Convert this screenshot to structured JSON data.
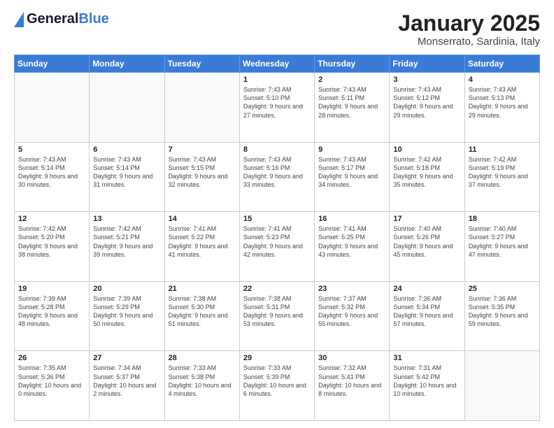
{
  "header": {
    "logo_general": "General",
    "logo_blue": "Blue",
    "title": "January 2025",
    "location": "Monserrato, Sardinia, Italy"
  },
  "weekdays": [
    "Sunday",
    "Monday",
    "Tuesday",
    "Wednesday",
    "Thursday",
    "Friday",
    "Saturday"
  ],
  "weeks": [
    [
      {
        "day": "",
        "info": ""
      },
      {
        "day": "",
        "info": ""
      },
      {
        "day": "",
        "info": ""
      },
      {
        "day": "1",
        "info": "Sunrise: 7:43 AM\nSunset: 5:10 PM\nDaylight: 9 hours and 27 minutes."
      },
      {
        "day": "2",
        "info": "Sunrise: 7:43 AM\nSunset: 5:11 PM\nDaylight: 9 hours and 28 minutes."
      },
      {
        "day": "3",
        "info": "Sunrise: 7:43 AM\nSunset: 5:12 PM\nDaylight: 9 hours and 29 minutes."
      },
      {
        "day": "4",
        "info": "Sunrise: 7:43 AM\nSunset: 5:13 PM\nDaylight: 9 hours and 29 minutes."
      }
    ],
    [
      {
        "day": "5",
        "info": "Sunrise: 7:43 AM\nSunset: 5:14 PM\nDaylight: 9 hours and 30 minutes."
      },
      {
        "day": "6",
        "info": "Sunrise: 7:43 AM\nSunset: 5:14 PM\nDaylight: 9 hours and 31 minutes."
      },
      {
        "day": "7",
        "info": "Sunrise: 7:43 AM\nSunset: 5:15 PM\nDaylight: 9 hours and 32 minutes."
      },
      {
        "day": "8",
        "info": "Sunrise: 7:43 AM\nSunset: 5:16 PM\nDaylight: 9 hours and 33 minutes."
      },
      {
        "day": "9",
        "info": "Sunrise: 7:43 AM\nSunset: 5:17 PM\nDaylight: 9 hours and 34 minutes."
      },
      {
        "day": "10",
        "info": "Sunrise: 7:42 AM\nSunset: 5:18 PM\nDaylight: 9 hours and 35 minutes."
      },
      {
        "day": "11",
        "info": "Sunrise: 7:42 AM\nSunset: 5:19 PM\nDaylight: 9 hours and 37 minutes."
      }
    ],
    [
      {
        "day": "12",
        "info": "Sunrise: 7:42 AM\nSunset: 5:20 PM\nDaylight: 9 hours and 38 minutes."
      },
      {
        "day": "13",
        "info": "Sunrise: 7:42 AM\nSunset: 5:21 PM\nDaylight: 9 hours and 39 minutes."
      },
      {
        "day": "14",
        "info": "Sunrise: 7:41 AM\nSunset: 5:22 PM\nDaylight: 9 hours and 41 minutes."
      },
      {
        "day": "15",
        "info": "Sunrise: 7:41 AM\nSunset: 5:23 PM\nDaylight: 9 hours and 42 minutes."
      },
      {
        "day": "16",
        "info": "Sunrise: 7:41 AM\nSunset: 5:25 PM\nDaylight: 9 hours and 43 minutes."
      },
      {
        "day": "17",
        "info": "Sunrise: 7:40 AM\nSunset: 5:26 PM\nDaylight: 9 hours and 45 minutes."
      },
      {
        "day": "18",
        "info": "Sunrise: 7:40 AM\nSunset: 5:27 PM\nDaylight: 9 hours and 47 minutes."
      }
    ],
    [
      {
        "day": "19",
        "info": "Sunrise: 7:39 AM\nSunset: 5:28 PM\nDaylight: 9 hours and 48 minutes."
      },
      {
        "day": "20",
        "info": "Sunrise: 7:39 AM\nSunset: 5:29 PM\nDaylight: 9 hours and 50 minutes."
      },
      {
        "day": "21",
        "info": "Sunrise: 7:38 AM\nSunset: 5:30 PM\nDaylight: 9 hours and 51 minutes."
      },
      {
        "day": "22",
        "info": "Sunrise: 7:38 AM\nSunset: 5:31 PM\nDaylight: 9 hours and 53 minutes."
      },
      {
        "day": "23",
        "info": "Sunrise: 7:37 AM\nSunset: 5:32 PM\nDaylight: 9 hours and 55 minutes."
      },
      {
        "day": "24",
        "info": "Sunrise: 7:36 AM\nSunset: 5:34 PM\nDaylight: 9 hours and 57 minutes."
      },
      {
        "day": "25",
        "info": "Sunrise: 7:36 AM\nSunset: 5:35 PM\nDaylight: 9 hours and 59 minutes."
      }
    ],
    [
      {
        "day": "26",
        "info": "Sunrise: 7:35 AM\nSunset: 5:36 PM\nDaylight: 10 hours and 0 minutes."
      },
      {
        "day": "27",
        "info": "Sunrise: 7:34 AM\nSunset: 5:37 PM\nDaylight: 10 hours and 2 minutes."
      },
      {
        "day": "28",
        "info": "Sunrise: 7:33 AM\nSunset: 5:38 PM\nDaylight: 10 hours and 4 minutes."
      },
      {
        "day": "29",
        "info": "Sunrise: 7:33 AM\nSunset: 5:39 PM\nDaylight: 10 hours and 6 minutes."
      },
      {
        "day": "30",
        "info": "Sunrise: 7:32 AM\nSunset: 5:41 PM\nDaylight: 10 hours and 8 minutes."
      },
      {
        "day": "31",
        "info": "Sunrise: 7:31 AM\nSunset: 5:42 PM\nDaylight: 10 hours and 10 minutes."
      },
      {
        "day": "",
        "info": ""
      }
    ]
  ]
}
